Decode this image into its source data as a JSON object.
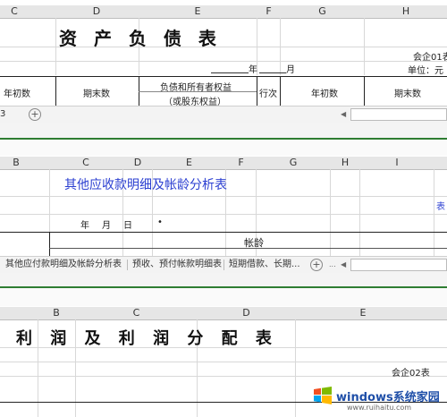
{
  "panel1": {
    "columns": [
      "C",
      "D",
      "E",
      "F",
      "G",
      "H"
    ],
    "title": "资 产 负 债 表",
    "form_code": "会企01表",
    "date_line": {
      "year": "年",
      "month": "月"
    },
    "unit": "单位：元",
    "headers": {
      "begin": "年初数",
      "end": "期末数",
      "equity_1": "负债和所有者权益",
      "equity_2": "（或股东权益）",
      "row_no": "行次",
      "begin2": "年初数",
      "end2": "期末数"
    },
    "sheet_fragment": "3"
  },
  "panel2": {
    "columns": [
      "B",
      "C",
      "D",
      "E",
      "F",
      "G",
      "H",
      "I"
    ],
    "title": "其他应收款明细及帐龄分析表",
    "corner": "表",
    "date_line": "年　月　日",
    "dot": "•",
    "aging": "帐龄",
    "tabs": [
      "其他应付款明细及帐龄分析表",
      "预收、预付帐款明细表",
      "短期借款、长期..."
    ],
    "more": "..."
  },
  "panel3": {
    "columns": [
      "B",
      "C",
      "D",
      "E"
    ],
    "title": "利 润 及 利 润 分 配 表",
    "form_code": "会企02表"
  },
  "watermark": {
    "brand": "windows系统家园",
    "url": "www.ruihaitu.com"
  },
  "colors": {
    "title2": "#2b3fd1",
    "corner2": "#2b3fd1",
    "green_divider": "#2e7d32"
  }
}
